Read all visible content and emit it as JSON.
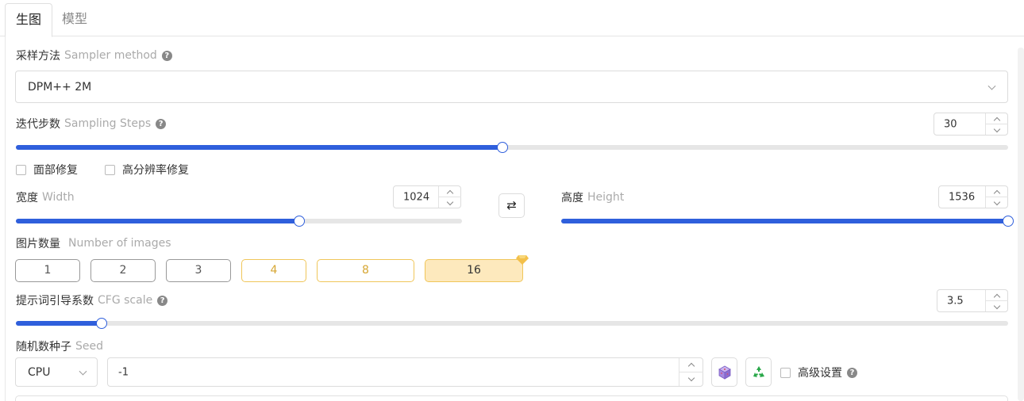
{
  "tabs": [
    {
      "label": "生图",
      "active": true
    },
    {
      "label": "模型",
      "active": false
    }
  ],
  "sampler": {
    "label_cn": "采样方法",
    "label_en": "Sampler method",
    "value": "DPM++ 2M"
  },
  "steps": {
    "label_cn": "迭代步数",
    "label_en": "Sampling Steps",
    "value": "30",
    "slider_fraction": 0.49
  },
  "checkboxes": [
    {
      "label": "面部修复",
      "checked": false
    },
    {
      "label": "高分辨率修复",
      "checked": false
    }
  ],
  "width": {
    "label_cn": "宽度",
    "label_en": "Width",
    "value": "1024",
    "slider_fraction": 0.636
  },
  "swap_button": {
    "symbol": "⇄",
    "icon": "swap-arrows-icon"
  },
  "height": {
    "label_cn": "高度",
    "label_en": "Height",
    "value": "1536",
    "slider_fraction": 1.0
  },
  "num_images": {
    "label_cn": "图片数量",
    "label_en": "Number of images",
    "options": [
      "1",
      "2",
      "3",
      "4",
      "8",
      "16"
    ],
    "selected": "16",
    "premium_options": [
      "4",
      "8",
      "16"
    ],
    "premium_icon": "diamond-icon"
  },
  "cfg": {
    "label_cn": "提示词引导系数",
    "label_en": "CFG scale",
    "value": "3.5",
    "slider_fraction": 0.086
  },
  "seed": {
    "label_cn": "随机数种子",
    "label_en": "Seed",
    "device": "CPU",
    "value": "-1",
    "random_icon": "dice-icon",
    "reuse_icon": "recycle-icon"
  },
  "advanced": {
    "label": "高级设置",
    "checked": false
  },
  "colors": {
    "accent": "#2f5fdc",
    "gold_border": "#f0c65a",
    "gold_text": "#d6a632",
    "selected_bg": "#fde9bd",
    "recycle_green": "#2aa84a",
    "dice_purple": "#7b5cc4"
  }
}
